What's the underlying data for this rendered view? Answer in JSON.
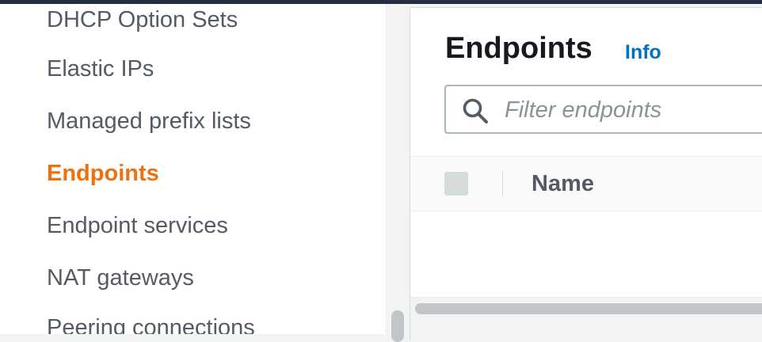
{
  "sidebar": {
    "items": [
      {
        "label": "DHCP Option Sets",
        "active": false
      },
      {
        "label": "Elastic IPs",
        "active": false
      },
      {
        "label": "Managed prefix lists",
        "active": false
      },
      {
        "label": "Endpoints",
        "active": true
      },
      {
        "label": "Endpoint services",
        "active": false
      },
      {
        "label": "NAT gateways",
        "active": false
      },
      {
        "label": "Peering connections",
        "active": false
      }
    ]
  },
  "main": {
    "title": "Endpoints",
    "info_link": "Info",
    "filter": {
      "placeholder": "Filter endpoints",
      "value": ""
    },
    "table": {
      "columns": [
        "Name"
      ],
      "rows": []
    }
  },
  "colors": {
    "active_nav": "#ec7211",
    "link": "#0073bb",
    "topbar": "#232f3e"
  }
}
